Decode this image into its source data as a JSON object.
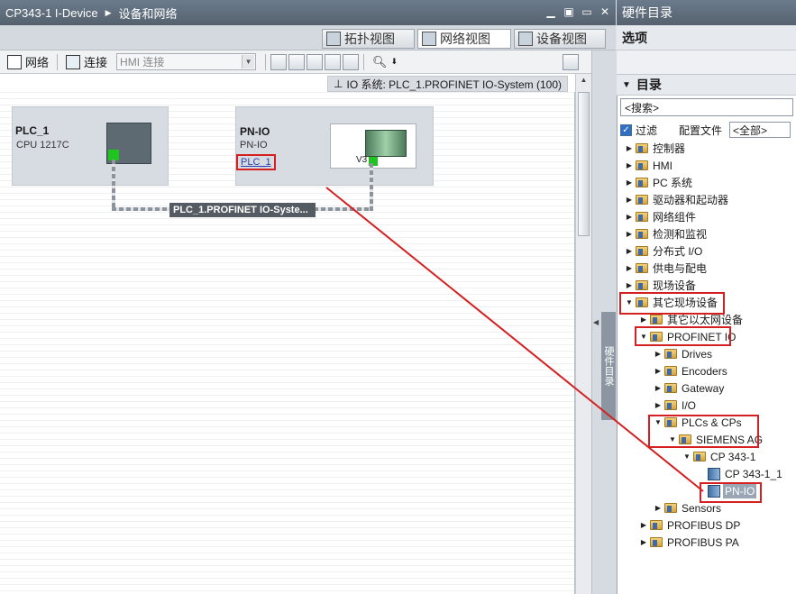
{
  "left_title": {
    "project": "CP343-1 I-Device",
    "section": "设备和网络"
  },
  "view_tabs": {
    "topology": "拓扑视图",
    "network": "网络视图",
    "device": "设备视图"
  },
  "toolbar": {
    "network": "网络",
    "connections": "连接",
    "hmi_select": "HMI 连接"
  },
  "io_system": "IO 系统: PLC_1.PROFINET IO-System (100)",
  "devices": {
    "plc": {
      "name": "PLC_1",
      "type": "CPU 1217C"
    },
    "pnio": {
      "name": "PN-IO",
      "type": "PN-IO",
      "link": "PLC_1",
      "v3": "V3"
    }
  },
  "network_label": "PLC_1.PROFINET IO-Syste...",
  "side_tab": "硬件目录",
  "right_panel": {
    "title": "硬件目录",
    "options": "选项",
    "catalog": "目录",
    "search": "<搜索>",
    "filter": "过滤",
    "profile_label": "配置文件",
    "profile_value": "<全部>"
  },
  "tree": [
    {
      "label": "控制器",
      "level": 0,
      "state": "closed"
    },
    {
      "label": "HMI",
      "level": 0,
      "state": "closed"
    },
    {
      "label": "PC 系统",
      "level": 0,
      "state": "closed"
    },
    {
      "label": "驱动器和起动器",
      "level": 0,
      "state": "closed"
    },
    {
      "label": "网络组件",
      "level": 0,
      "state": "closed"
    },
    {
      "label": "检测和监视",
      "level": 0,
      "state": "closed"
    },
    {
      "label": "分布式 I/O",
      "level": 0,
      "state": "closed"
    },
    {
      "label": "供电与配电",
      "level": 0,
      "state": "closed"
    },
    {
      "label": "现场设备",
      "level": 0,
      "state": "closed"
    },
    {
      "label": "其它现场设备",
      "level": 0,
      "state": "open"
    },
    {
      "label": "其它以太网设备",
      "level": 1,
      "state": "closed"
    },
    {
      "label": "PROFINET IO",
      "level": 1,
      "state": "open"
    },
    {
      "label": "Drives",
      "level": 2,
      "state": "closed"
    },
    {
      "label": "Encoders",
      "level": 2,
      "state": "closed"
    },
    {
      "label": "Gateway",
      "level": 2,
      "state": "closed"
    },
    {
      "label": "I/O",
      "level": 2,
      "state": "closed"
    },
    {
      "label": "PLCs & CPs",
      "level": 2,
      "state": "open"
    },
    {
      "label": "SIEMENS AG",
      "level": 3,
      "state": "open"
    },
    {
      "label": "CP 343-1",
      "level": 4,
      "state": "open"
    },
    {
      "label": "CP 343-1_1",
      "level": 5,
      "state": "leaf"
    },
    {
      "label": "PN-IO",
      "level": 5,
      "state": "leaf",
      "selected": true
    },
    {
      "label": "Sensors",
      "level": 2,
      "state": "closed"
    },
    {
      "label": "PROFIBUS DP",
      "level": 1,
      "state": "closed"
    },
    {
      "label": "PROFIBUS PA",
      "level": 1,
      "state": "closed"
    }
  ],
  "colors": {
    "highlight": "#d42020",
    "titlebar": "#5f6d7c",
    "device_bg": "#d7dce3"
  }
}
